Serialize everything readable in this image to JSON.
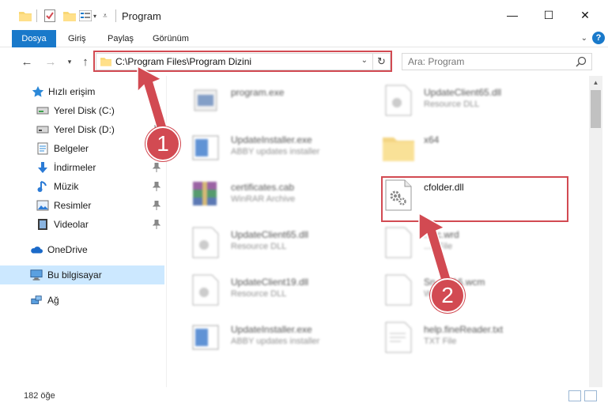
{
  "window": {
    "title": "Program",
    "minimize": "—",
    "maximize": "☐",
    "close": "✕"
  },
  "ribbon": {
    "tabs": [
      {
        "label": "Dosya"
      },
      {
        "label": "Giriş"
      },
      {
        "label": "Paylaş"
      },
      {
        "label": "Görünüm"
      }
    ],
    "help": "?"
  },
  "nav": {
    "address": "C:\\Program Files\\Program Dizini",
    "search_placeholder": "Ara: Program"
  },
  "sidebar": {
    "items": [
      {
        "label": "Hızlı erişim",
        "icon": "star-icon"
      },
      {
        "label": "Yerel Disk (C:)",
        "icon": "drive-icon"
      },
      {
        "label": "Yerel Disk (D:)",
        "icon": "drive-icon"
      },
      {
        "label": "Belgeler",
        "icon": "documents-icon"
      },
      {
        "label": "İndirmeler",
        "icon": "download-icon"
      },
      {
        "label": "Müzik",
        "icon": "music-icon"
      },
      {
        "label": "Resimler",
        "icon": "pictures-icon"
      },
      {
        "label": "Videolar",
        "icon": "video-icon"
      },
      {
        "label": "OneDrive",
        "icon": "cloud-icon"
      },
      {
        "label": "Bu bilgisayar",
        "icon": "computer-icon"
      },
      {
        "label": "Ağ",
        "icon": "network-icon"
      }
    ]
  },
  "files": [
    {
      "name": "program.exe",
      "type": ""
    },
    {
      "name": "UpdateClient65.dll",
      "type": "Resource DLL"
    },
    {
      "name": "UpdateInstaller.exe",
      "type": "ABBY updates installer"
    },
    {
      "name": "x64",
      "type": ""
    },
    {
      "name": "certificates.cab",
      "type": "WinRAR Archive"
    },
    {
      "name": "cfolder.dll",
      "type": ""
    },
    {
      "name": "UpdateClient65.dll",
      "type": "Resource DLL"
    },
    {
      "name": "...sc.wrd",
      "type": "...d File"
    },
    {
      "name": "UpdateClient19.dll",
      "type": "Resource DLL"
    },
    {
      "name": "Sn...IP16.wcm",
      "type": "W..."
    },
    {
      "name": "UpdateInstaller.exe",
      "type": "ABBY updates installer"
    },
    {
      "name": "help.fineReader.txt",
      "type": "TXT File"
    }
  ],
  "status": {
    "count": "182 öğe"
  },
  "annotations": {
    "step1": "1",
    "step2": "2"
  },
  "colors": {
    "accent": "#1979ca",
    "highlight": "#d24a52",
    "selected": "#cce8ff"
  }
}
